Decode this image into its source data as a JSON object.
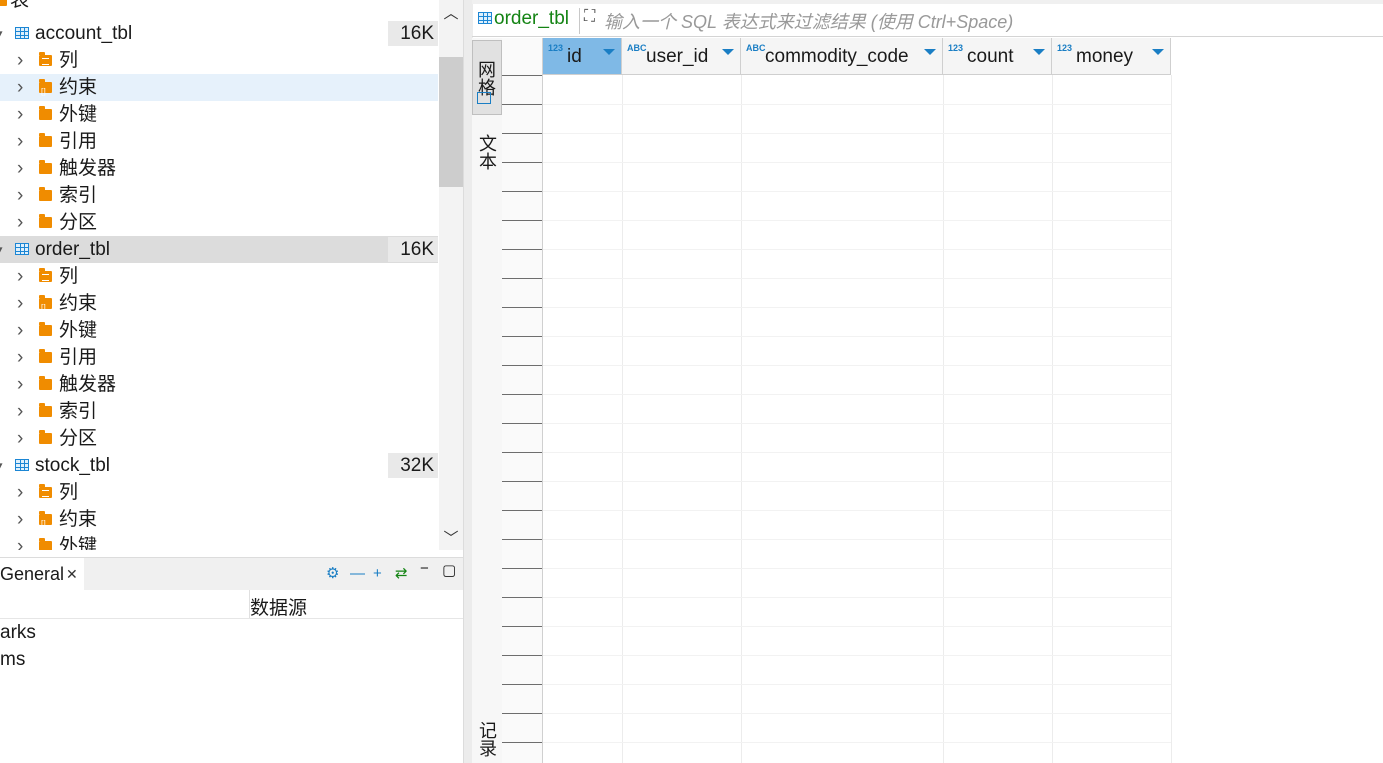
{
  "tree": {
    "root_label": "表",
    "tables": [
      {
        "name": "account_tbl",
        "size": "16K",
        "children": [
          "列",
          "约束",
          "外键",
          "引用",
          "触发器",
          "索引",
          "分区"
        ]
      },
      {
        "name": "order_tbl",
        "size": "16K",
        "children": [
          "列",
          "约束",
          "外键",
          "引用",
          "触发器",
          "索引",
          "分区"
        ]
      },
      {
        "name": "stock_tbl",
        "size": "32K",
        "children": [
          "列",
          "约束",
          "外键"
        ]
      }
    ]
  },
  "bottom_panel": {
    "tab_label": "General",
    "close_glyph": "✕",
    "header": "数据源",
    "rows": [
      "arks",
      "ms"
    ]
  },
  "editor": {
    "table_name": "order_tbl",
    "filter_placeholder": "输入一个 SQL 表达式来过滤结果 (使用 Ctrl+Space)",
    "side_tabs": {
      "grid": "网格",
      "text": "文本",
      "record": "记录"
    },
    "columns": [
      {
        "type": "123",
        "name": "id"
      },
      {
        "type": "ABC",
        "name": "user_id"
      },
      {
        "type": "ABC",
        "name": "commodity_code"
      },
      {
        "type": "123",
        "name": "count"
      },
      {
        "type": "123",
        "name": "money"
      }
    ]
  },
  "colors": {
    "accent": "#1a7ec4",
    "selected_header": "#7fb9e6",
    "folder": "#f08c00",
    "table_name_green": "#148414"
  },
  "icons": [
    "table-icon",
    "folder-icon",
    "gear-icon",
    "minus-icon",
    "plus-icon",
    "swap-icon",
    "minimize-icon",
    "maximize-icon",
    "expand-icon",
    "grid-icon"
  ]
}
